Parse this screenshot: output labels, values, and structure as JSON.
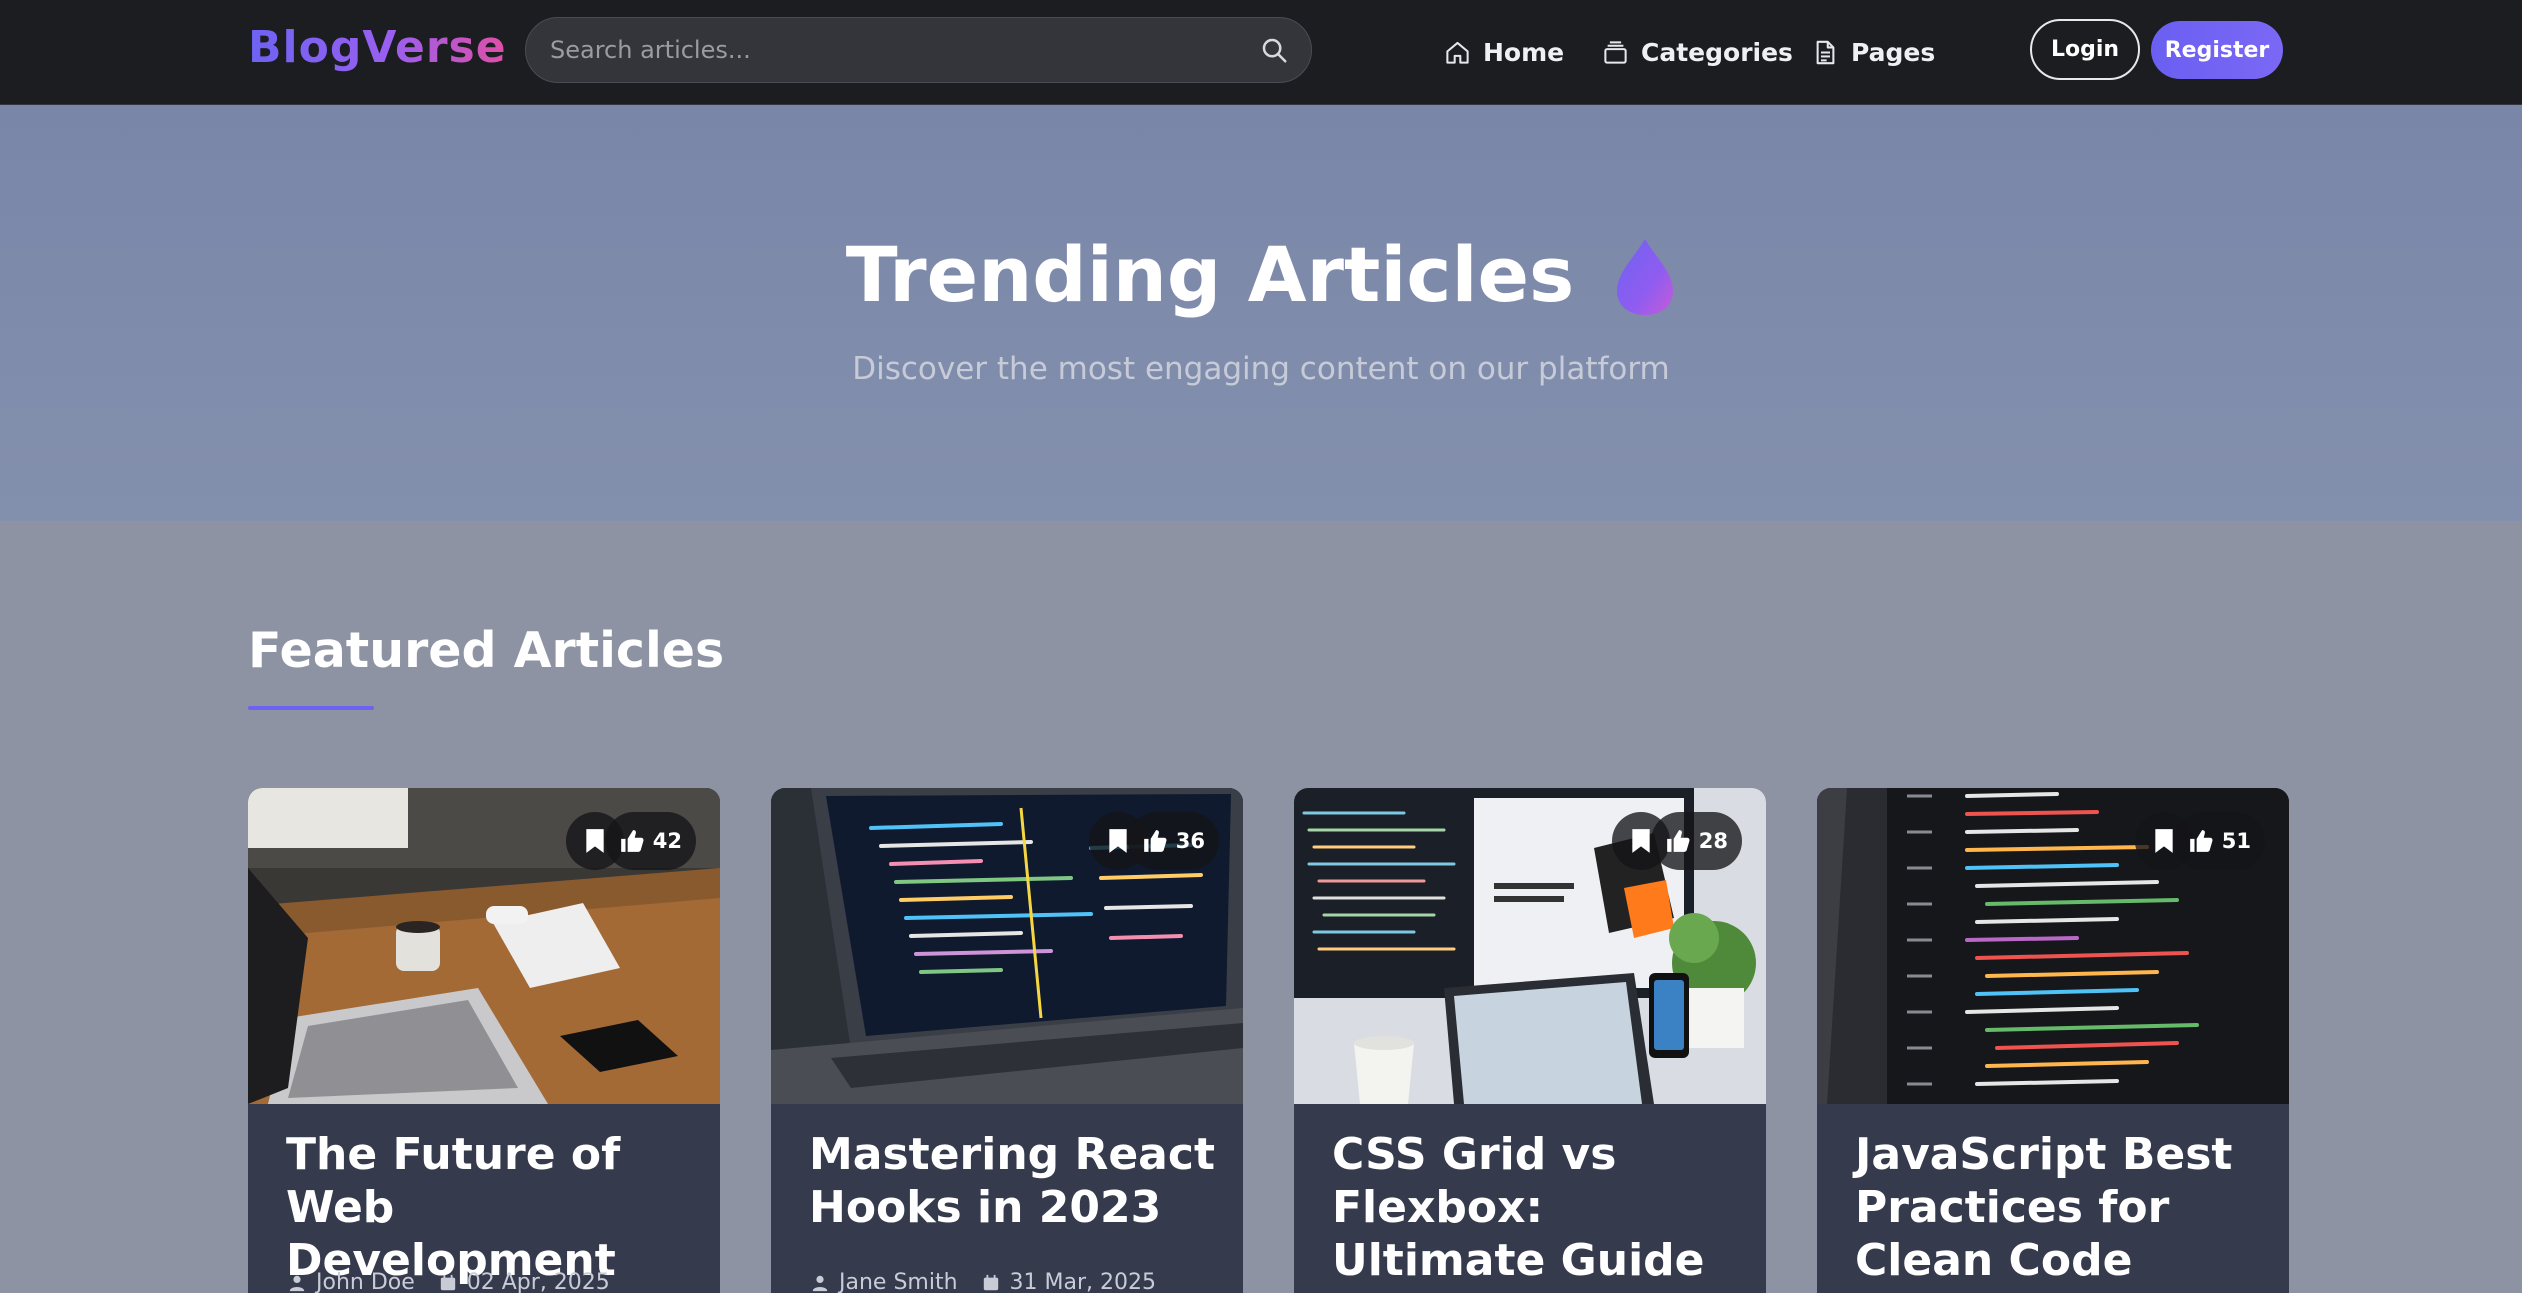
{
  "brand": {
    "name": "BlogVerse"
  },
  "search": {
    "placeholder": "Search articles..."
  },
  "nav": {
    "home": "Home",
    "categories": "Categories",
    "pages": "Pages",
    "login": "Login",
    "register": "Register"
  },
  "hero": {
    "title": "Trending Articles",
    "subtitle": "Discover the most engaging content on our platform"
  },
  "section": {
    "title": "Featured Articles"
  },
  "articles": [
    {
      "title": "The Future of Web Development",
      "author": "John Doe",
      "date": "02 Apr, 2025",
      "likes": "42",
      "image": "laptop-on-wooden-desk"
    },
    {
      "title": "Mastering React Hooks in 2023",
      "author": "Jane Smith",
      "date": "31 Mar, 2025",
      "likes": "36",
      "image": "laptop-with-code-editor"
    },
    {
      "title": "CSS Grid vs Flexbox: Ultimate Guide",
      "author": "",
      "date": "",
      "likes": "28",
      "image": "monitor-and-tablet-workspace"
    },
    {
      "title": "JavaScript Best Practices for Clean Code",
      "author": "",
      "date": "",
      "likes": "51",
      "image": "python-code-on-screen"
    }
  ],
  "icons": {
    "search": "search-icon",
    "home": "home-icon",
    "categories": "layers-icon",
    "pages": "document-icon",
    "trending": "fire-icon",
    "bookmark": "bookmark-icon",
    "like": "thumbs-up-icon",
    "author": "user-icon",
    "date": "calendar-icon"
  },
  "colors": {
    "navbar": "#1c1d21",
    "accent": "#6d63f2",
    "brand_gradient_end": "#e04fa6",
    "hero": "#7a86a8",
    "page": "#8e93a4",
    "card_body": "#363a4d"
  }
}
